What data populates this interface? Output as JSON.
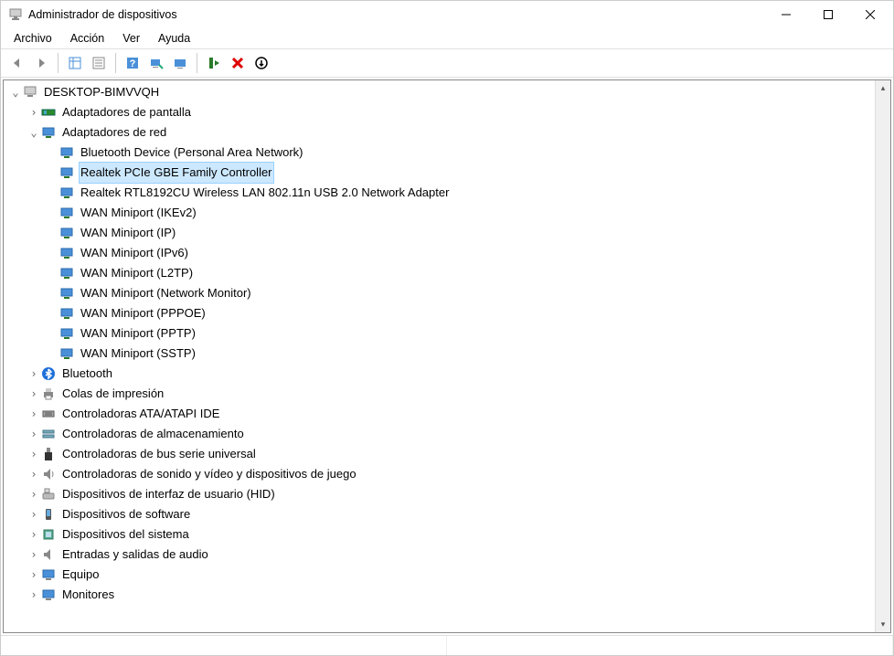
{
  "window": {
    "title": "Administrador de dispositivos"
  },
  "menu": {
    "file": "Archivo",
    "action": "Acción",
    "view": "Ver",
    "help": "Ayuda"
  },
  "tree": {
    "root": "DESKTOP-BIMVVQH",
    "display_adapters": "Adaptadores de pantalla",
    "network_adapters": "Adaptadores de red",
    "net_items": {
      "bt_pan": "Bluetooth Device (Personal Area Network)",
      "realtek_gbe": "Realtek PCIe GBE Family Controller",
      "realtek_wlan": "Realtek RTL8192CU Wireless LAN 802.11n USB 2.0 Network Adapter",
      "wan_ikev2": "WAN Miniport (IKEv2)",
      "wan_ip": "WAN Miniport (IP)",
      "wan_ipv6": "WAN Miniport (IPv6)",
      "wan_l2tp": "WAN Miniport (L2TP)",
      "wan_netmon": "WAN Miniport (Network Monitor)",
      "wan_pppoe": "WAN Miniport (PPPOE)",
      "wan_pptp": "WAN Miniport (PPTP)",
      "wan_sstp": "WAN Miniport (SSTP)"
    },
    "bluetooth": "Bluetooth",
    "print_queues": "Colas de impresión",
    "ata_atapi": "Controladoras ATA/ATAPI IDE",
    "storage_ctrl": "Controladoras de almacenamiento",
    "usb_ctrl": "Controladoras de bus serie universal",
    "sound_video": "Controladoras de sonido y vídeo y dispositivos de juego",
    "hid": "Dispositivos de interfaz de usuario (HID)",
    "software_dev": "Dispositivos de software",
    "system_dev": "Dispositivos del sistema",
    "audio_io": "Entradas y salidas de audio",
    "computer": "Equipo",
    "monitors": "Monitores"
  }
}
